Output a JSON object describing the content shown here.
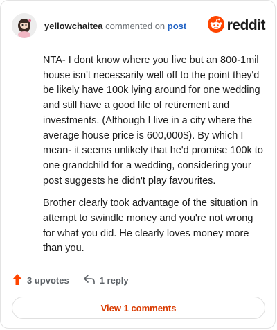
{
  "header": {
    "username": "yellowchaitea",
    "action": "commented on",
    "post_link": "post",
    "brand_icon": "reddit-snoo-icon",
    "brand_name": "reddit"
  },
  "comment": {
    "paragraphs": [
      "NTA- I dont know where you live but an 800-1mil house isn't necessarily well off to the point they'd be likely have 100k lying around for one wedding and still have a good life of retirement and investments. (Although I live in a city where the average house price is 600,000$). By which I mean- it seems unlikely that he'd promise 100k to one grandchild for a wedding, considering your post suggests he didn't play favourites.",
      "Brother clearly took advantage of the situation in attempt to swindle money and you're not wrong for what you did. He clearly loves money more than you."
    ]
  },
  "footer": {
    "upvotes": "3 upvotes",
    "replies": "1 reply",
    "view_comments": "View 1 comments"
  },
  "colors": {
    "brand": "#ff4500",
    "upvote": "#ff4500",
    "link": "#2162c4",
    "view_button_text": "#d93a00"
  }
}
